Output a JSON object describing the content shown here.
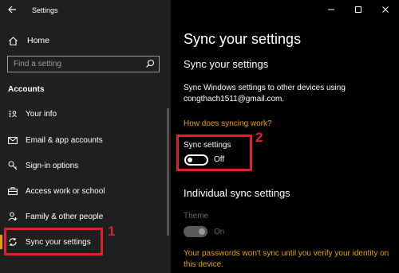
{
  "window": {
    "title": "Settings",
    "controls": [
      "minimize-icon",
      "maximize-icon",
      "close-icon"
    ]
  },
  "sidebar": {
    "home_label": "Home",
    "search_placeholder": "Find a setting",
    "section_label": "Accounts",
    "items": [
      {
        "label": "Your info",
        "icon": "person-card-icon"
      },
      {
        "label": "Email & app accounts",
        "icon": "mail-icon"
      },
      {
        "label": "Sign-in options",
        "icon": "key-icon"
      },
      {
        "label": "Access work or school",
        "icon": "briefcase-icon"
      },
      {
        "label": "Family & other people",
        "icon": "people-icon"
      },
      {
        "label": "Sync your settings",
        "icon": "sync-icon",
        "selected": true
      }
    ]
  },
  "main": {
    "title": "Sync your settings",
    "sub_heading": "Sync your settings",
    "description": "Sync Windows settings to other devices using congthach1511@gmail.com.",
    "link": "How does syncing work?",
    "sync_settings_label": "Sync settings",
    "sync_settings_state": "Off",
    "individual_heading": "Individual sync settings",
    "theme_label": "Theme",
    "theme_state": "On",
    "warning": "Your passwords won't sync until you verify your identity on this device."
  },
  "annotations": {
    "marker_1": "1",
    "marker_2": "2"
  },
  "colors": {
    "accent": "#e6a000",
    "annotation": "#e0202c",
    "sidebar_bg": "#1f1f1f",
    "main_bg": "#000000"
  }
}
